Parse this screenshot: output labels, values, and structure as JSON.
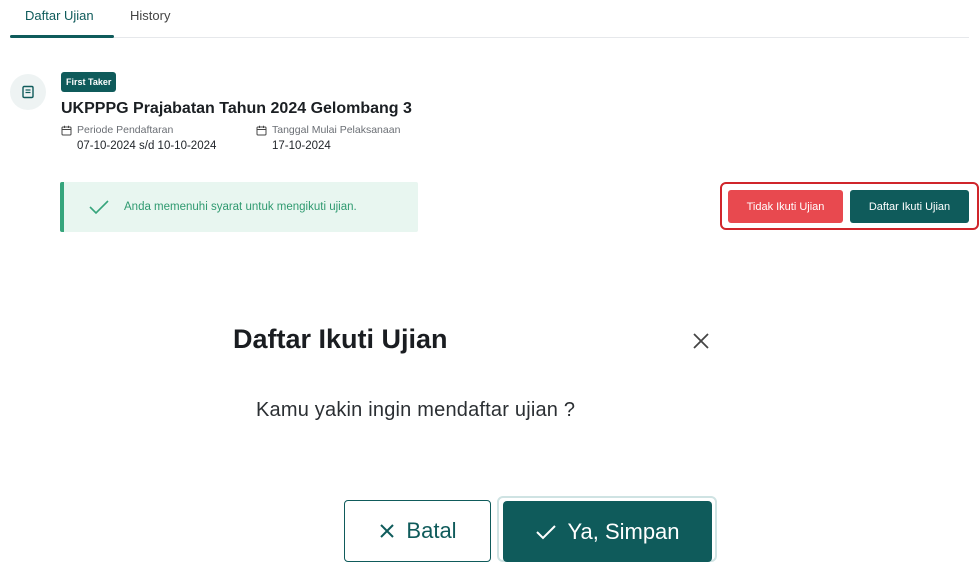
{
  "tabs": [
    {
      "label": "Daftar Ujian",
      "active": true
    },
    {
      "label": "History",
      "active": false
    }
  ],
  "exam": {
    "badge": "First Taker",
    "title": "UKPPPG Prajabatan Tahun 2024 Gelombang 3",
    "registration_label": "Periode Pendaftaran",
    "registration_value": "07-10-2024 s/d 10-10-2024",
    "start_label": "Tanggal Mulai Pelaksanaan",
    "start_value": "17-10-2024",
    "eligibility_message": "Anda memenuhi syarat untuk mengikuti ujian."
  },
  "actions": {
    "decline_label": "Tidak Ikuti Ujian",
    "register_label": "Daftar Ikuti Ujian"
  },
  "dialog": {
    "title": "Daftar Ikuti Ujian",
    "message": "Kamu yakin ingin mendaftar ujian ?",
    "cancel_label": "Batal",
    "confirm_label": "Ya, Simpan"
  },
  "colors": {
    "primary": "#0f5b5b",
    "danger": "#e8494f",
    "success_text": "#2f9a70",
    "success_bg": "#e8f6f0",
    "highlight_frame": "#d0252b"
  }
}
